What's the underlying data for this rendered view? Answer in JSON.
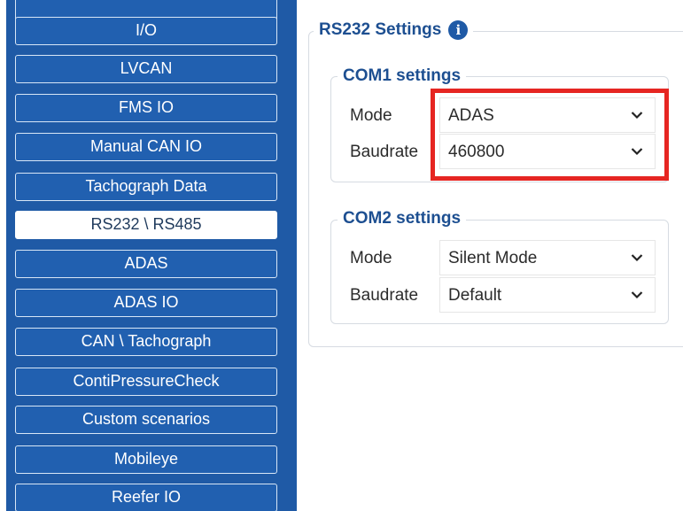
{
  "sidebar": {
    "items": [
      {
        "label": ""
      },
      {
        "label": "I/O"
      },
      {
        "label": "LVCAN"
      },
      {
        "label": "FMS IO"
      },
      {
        "label": "Manual CAN IO"
      },
      {
        "label": "Tachograph Data"
      },
      {
        "label": "RS232 \\ RS485",
        "active": true
      },
      {
        "label": "ADAS"
      },
      {
        "label": "ADAS IO"
      },
      {
        "label": "CAN \\ Tachograph"
      },
      {
        "label": "ContiPressureCheck"
      },
      {
        "label": "Custom scenarios"
      },
      {
        "label": "Mobileye"
      },
      {
        "label": "Reefer IO"
      }
    ]
  },
  "main": {
    "title": "RS232 Settings",
    "info_icon": "info-icon",
    "com1": {
      "title": "COM1 settings",
      "mode_label": "Mode",
      "mode_value": "ADAS",
      "baud_label": "Baudrate",
      "baud_value": "460800"
    },
    "com2": {
      "title": "COM2 settings",
      "mode_label": "Mode",
      "mode_value": "Silent Mode",
      "baud_label": "Baudrate",
      "baud_value": "Default"
    }
  },
  "colors": {
    "sidebar_bg": "#1f5aa6",
    "accent": "#1d4f91",
    "highlight": "#e62622"
  }
}
